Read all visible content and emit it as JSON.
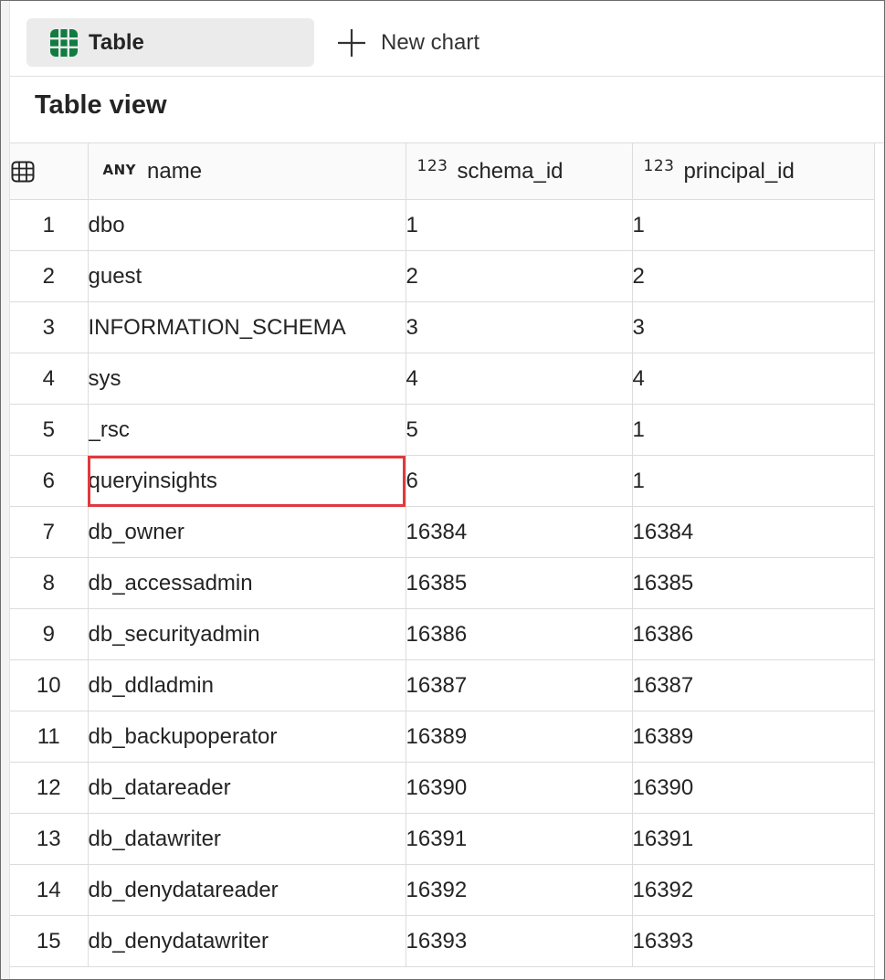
{
  "tabs": {
    "table_label": "Table",
    "new_chart_label": "New chart"
  },
  "view_title": "Table view",
  "columns": [
    {
      "type_badge": "ANY",
      "name": "name"
    },
    {
      "type_badge": "123",
      "name": "schema_id"
    },
    {
      "type_badge": "123",
      "name": "principal_id"
    }
  ],
  "rows": [
    {
      "n": "1",
      "name": "dbo",
      "schema_id": "1",
      "principal_id": "1"
    },
    {
      "n": "2",
      "name": "guest",
      "schema_id": "2",
      "principal_id": "2"
    },
    {
      "n": "3",
      "name": "INFORMATION_SCHEMA",
      "schema_id": "3",
      "principal_id": "3"
    },
    {
      "n": "4",
      "name": "sys",
      "schema_id": "4",
      "principal_id": "4"
    },
    {
      "n": "5",
      "name": "_rsc",
      "schema_id": "5",
      "principal_id": "1"
    },
    {
      "n": "6",
      "name": "queryinsights",
      "schema_id": "6",
      "principal_id": "1"
    },
    {
      "n": "7",
      "name": "db_owner",
      "schema_id": "16384",
      "principal_id": "16384"
    },
    {
      "n": "8",
      "name": "db_accessadmin",
      "schema_id": "16385",
      "principal_id": "16385"
    },
    {
      "n": "9",
      "name": "db_securityadmin",
      "schema_id": "16386",
      "principal_id": "16386"
    },
    {
      "n": "10",
      "name": "db_ddladmin",
      "schema_id": "16387",
      "principal_id": "16387"
    },
    {
      "n": "11",
      "name": "db_backupoperator",
      "schema_id": "16389",
      "principal_id": "16389"
    },
    {
      "n": "12",
      "name": "db_datareader",
      "schema_id": "16390",
      "principal_id": "16390"
    },
    {
      "n": "13",
      "name": "db_datawriter",
      "schema_id": "16391",
      "principal_id": "16391"
    },
    {
      "n": "14",
      "name": "db_denydatareader",
      "schema_id": "16392",
      "principal_id": "16392"
    },
    {
      "n": "15",
      "name": "db_denydatawriter",
      "schema_id": "16393",
      "principal_id": "16393"
    }
  ],
  "colors": {
    "accent_green": "#107c41",
    "highlight_red": "#e0393e"
  },
  "icons": {
    "table_tab": "table-grid-icon",
    "new_chart": "plus-icon",
    "corner": "table-select-all-icon"
  }
}
